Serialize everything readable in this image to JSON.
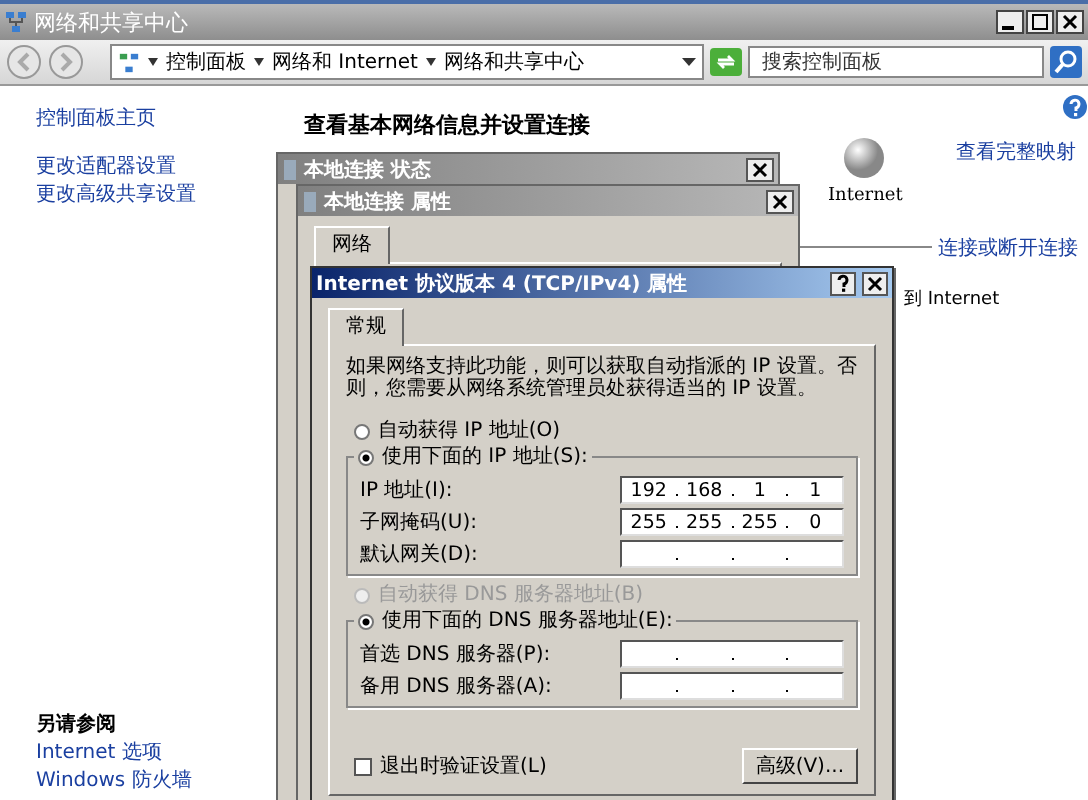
{
  "window": {
    "title": "网络和共享中心"
  },
  "address_bar": {
    "breadcrumbs": [
      "控制面板",
      "网络和 Internet",
      "网络和共享中心"
    ]
  },
  "search": {
    "placeholder": "搜索控制面板"
  },
  "sidebar": {
    "items": [
      "控制面板主页",
      "更改适配器设置",
      "更改高级共享设置"
    ],
    "see_also_title": "另请参阅",
    "see_also": [
      "Internet 选项",
      "Windows 防火墙"
    ]
  },
  "main": {
    "heading": "查看基本网络信息并设置连接",
    "full_map_link": "查看完整映射",
    "internet_label": "Internet",
    "connect_link": "连接或断开连接",
    "access_text": "到 Internet"
  },
  "status_dialog": {
    "title": "本地连接 状态"
  },
  "properties_dialog": {
    "title": "本地连接 属性",
    "tabs": [
      {
        "label": "网络",
        "selected": true
      }
    ]
  },
  "ipv4_dialog": {
    "title": "Internet 协议版本 4 (TCP/IPv4) 属性",
    "tabs": [
      {
        "label": "常规",
        "selected": true
      }
    ],
    "intro": "如果网络支持此功能，则可以获取自动指派的 IP 设置。否则，您需要从网络系统管理员处获得适当的 IP 设置。",
    "ip_options": [
      {
        "label": "自动获得 IP 地址(O)",
        "selected": false,
        "disabled": false
      },
      {
        "label": "使用下面的 IP 地址(S):",
        "selected": true,
        "disabled": false
      }
    ],
    "ip_fields": [
      {
        "label": "IP 地址(I):",
        "octets": [
          "192",
          "168",
          "1",
          "1"
        ]
      },
      {
        "label": "子网掩码(U):",
        "octets": [
          "255",
          "255",
          "255",
          "0"
        ]
      },
      {
        "label": "默认网关(D):"
      }
    ],
    "dns_options": [
      {
        "label": "自动获得 DNS 服务器地址(B)",
        "selected": false,
        "disabled": true
      },
      {
        "label": "使用下面的 DNS 服务器地址(E):",
        "selected": true,
        "disabled": false
      }
    ],
    "dns_fields": [
      {
        "label": "首选 DNS 服务器(P):"
      },
      {
        "label": "备用 DNS 服务器(A):"
      }
    ],
    "validate_checkbox": {
      "label": "退出时验证设置(L)",
      "checked": false
    },
    "advanced_button": "高级(V)..."
  }
}
